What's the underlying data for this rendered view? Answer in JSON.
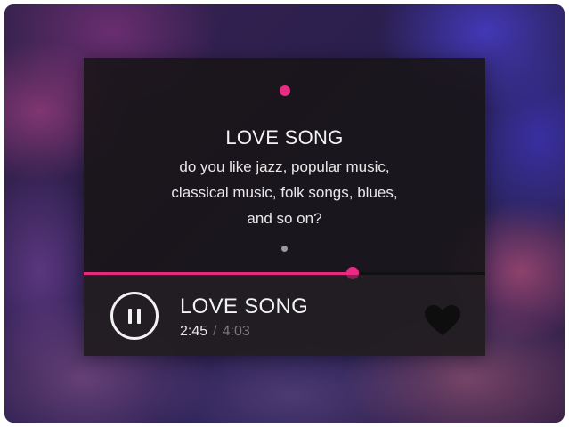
{
  "player": {
    "lyric_card": {
      "title": "LOVE SONG",
      "lines": [
        "do you like jazz, popular music,",
        "classical music, folk songs, blues,",
        "and so on?"
      ]
    },
    "progress": {
      "elapsed_fraction": 0.67,
      "fill_color": "#e8287f",
      "handle_color": "#ec2a83"
    },
    "now_playing": {
      "title": "LOVE SONG",
      "elapsed": "2:45",
      "separator": "/",
      "total": "4:03"
    },
    "controls": {
      "play_pause_icon": "pause-icon",
      "like_icon": "heart-icon",
      "like_color": "#0e0e0e"
    },
    "accent_color": "#ec2a83"
  }
}
